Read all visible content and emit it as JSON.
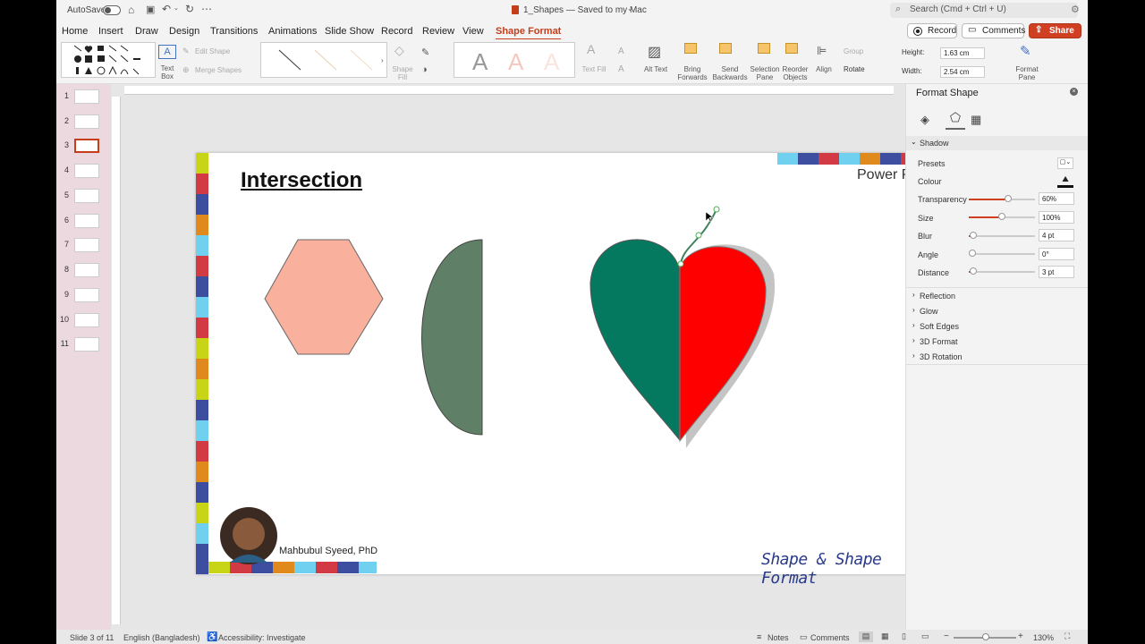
{
  "app": {
    "autosave": "AutoSave",
    "doc_title": "1_Shapes — Saved to my Mac",
    "search_placeholder": "Search (Cmd + Ctrl + U)"
  },
  "tabs": [
    "Home",
    "Insert",
    "Draw",
    "Design",
    "Transitions",
    "Animations",
    "Slide Show",
    "Record",
    "Review",
    "View",
    "Shape Format"
  ],
  "actions": {
    "record": "Record",
    "comments": "Comments",
    "share": "Share"
  },
  "ribbon": {
    "text_box": "Text Box",
    "edit_shape": "Edit Shape",
    "merge_shapes": "Merge Shapes",
    "shape_fill": "Shape Fill",
    "text_fill": "Text Fill",
    "alt_text": "Alt Text",
    "bring_forwards": "Bring Forwards",
    "send_backwards": "Send Backwards",
    "selection_pane": "Selection Pane",
    "reorder_objects": "Reorder Objects",
    "align": "Align",
    "group": "Group",
    "rotate": "Rotate",
    "height_label": "Height:",
    "height_value": "1.63 cm",
    "width_label": "Width:",
    "width_value": "2.54 cm",
    "format_pane": "Format Pane"
  },
  "slides": [
    "1",
    "2",
    "3",
    "4",
    "5",
    "6",
    "7",
    "8",
    "9",
    "10",
    "11"
  ],
  "slide": {
    "title": "Intersection",
    "brand": "Power Point",
    "author": "Mahbubul Syeed, PhD",
    "footer": "Shape & Shape Format"
  },
  "pane": {
    "title": "Format Shape",
    "section": "Shadow",
    "rows": [
      {
        "label": "Presets"
      },
      {
        "label": "Colour"
      },
      {
        "label": "Transparency",
        "value": "60%",
        "level": 0.6
      },
      {
        "label": "Size",
        "value": "100%",
        "level": 0.5
      },
      {
        "label": "Blur",
        "value": "4 pt",
        "level": 0.04
      },
      {
        "label": "Angle",
        "value": "0°",
        "level": 0
      },
      {
        "label": "Distance",
        "value": "3 pt",
        "level": 0.03
      }
    ],
    "sections": [
      "Reflection",
      "Glow",
      "Soft Edges",
      "3D Format",
      "3D Rotation"
    ]
  },
  "status": {
    "slide": "Slide 3 of 11",
    "language": "English (Bangladesh)",
    "accessibility": "Accessibility: Investigate",
    "notes": "Notes",
    "comments": "Comments",
    "zoom": "130%"
  },
  "colors": {
    "accent": "#c43e1c",
    "hexagon": "#f9b09c",
    "half_oval": "#5f7f66",
    "heart_left": "#057860",
    "heart_right": "#ff0000"
  }
}
